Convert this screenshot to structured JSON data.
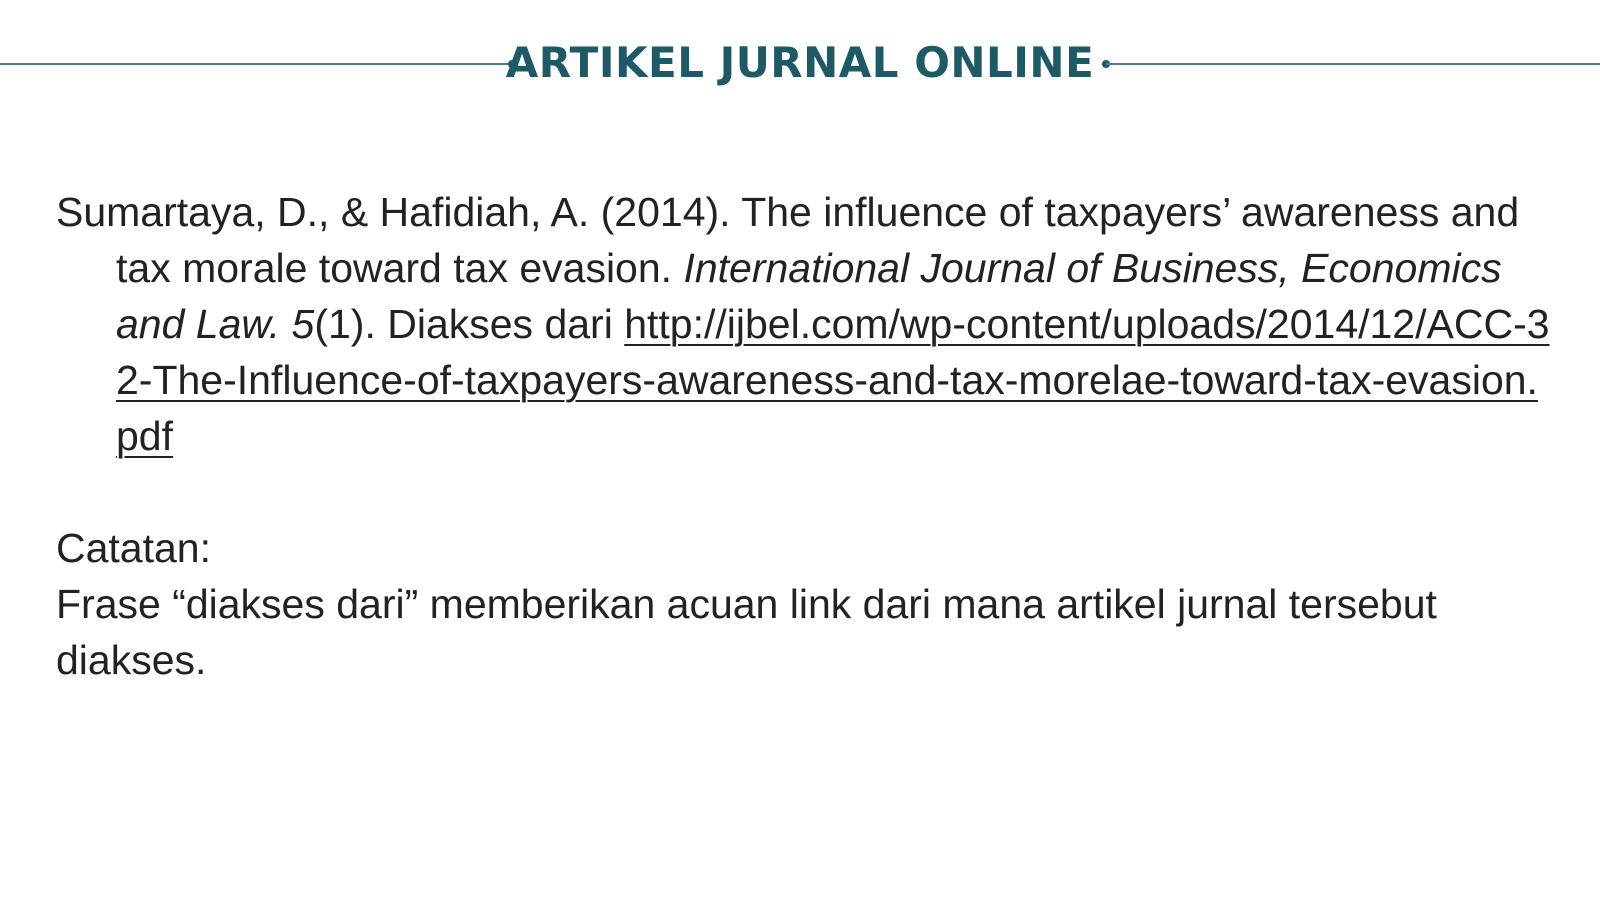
{
  "header": {
    "title": "ARTIKEL JURNAL ONLINE",
    "accent_color": "#1e5a66",
    "rule_color": "#4f7f84"
  },
  "reference": {
    "authors_year": "Sumartaya, D., & Hafidiah, A. (2014). The influence of taxpayers’ awareness and tax morale toward tax evasion. ",
    "journal": "International Journal of Business, Economics and Law. 5",
    "issue": "(1).  Diakses dari ",
    "url": "http://ijbel.com/wp-content/uploads/2014/12/ACC-32-The-Influence-of-taxpayers-awareness-and-tax-morelae-toward-tax-evasion.pdf"
  },
  "note": {
    "label": "Catatan:",
    "text": "Frase “diakses dari” memberikan acuan link dari mana artikel jurnal tersebut diakses."
  }
}
